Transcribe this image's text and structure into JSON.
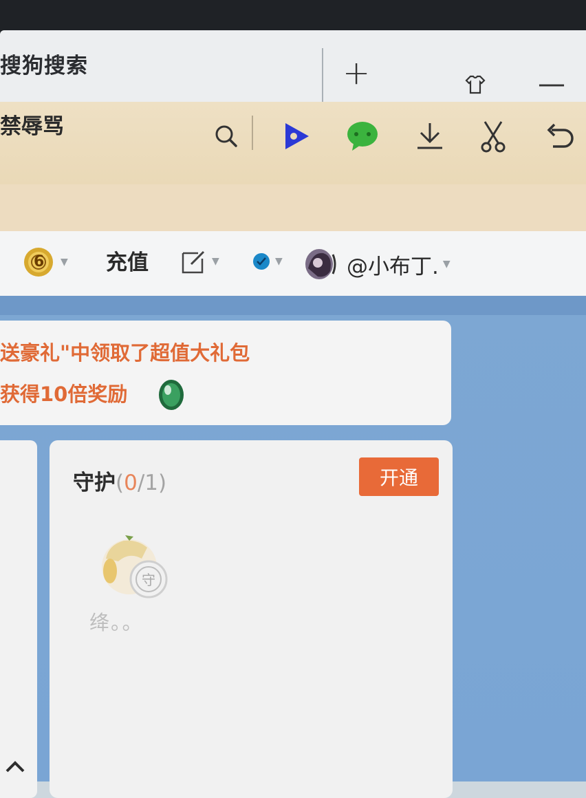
{
  "browser": {
    "tab_title": "搜狗搜索",
    "new_tab_glyph": "+",
    "minimize_glyph": "—",
    "icons": [
      "new-tab-icon",
      "skin-shirt-icon",
      "minimize-icon"
    ]
  },
  "toolbar": {
    "search_text": "禁辱骂",
    "icons": [
      "search-icon",
      "video-play-icon",
      "chat-bubble-icon",
      "download-icon",
      "scissors-icon",
      "undo-icon"
    ]
  },
  "user_nav": {
    "level_badge": "6",
    "recharge_label": "充值",
    "username": "@小布丁."
  },
  "notice": {
    "line1": "送豪礼\"中领取了超值大礼包",
    "line2": "获得10倍奖励"
  },
  "guard": {
    "title": "守护",
    "count_open": "(",
    "count_current": "0",
    "count_total": "/1)",
    "open_button": "开通",
    "member_name": "绛。。"
  },
  "colors": {
    "accent_orange": "#e86a38",
    "notice_text": "#e06a36",
    "toolbar_bg": "#ead9b7",
    "content_bg": "#7aa5d4"
  }
}
